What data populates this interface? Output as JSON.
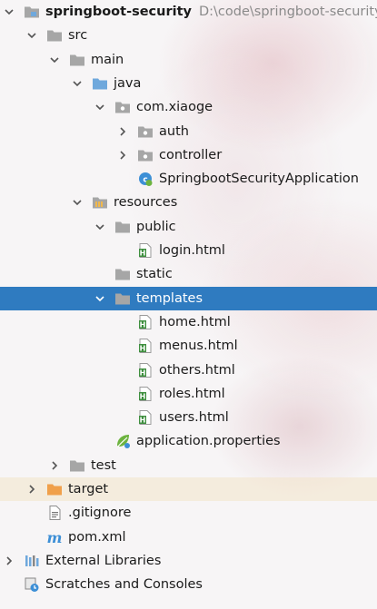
{
  "tree": [
    {
      "name": "tree-node-springboot-security",
      "level": 0,
      "arrow": "down",
      "icon": "module-folder-icon",
      "label": "springboot-security",
      "path": "D:\\code\\springboot-security",
      "bold": true
    },
    {
      "name": "tree-node-src",
      "level": 1,
      "arrow": "down",
      "icon": "folder-icon",
      "label": "src"
    },
    {
      "name": "tree-node-main",
      "level": 2,
      "arrow": "down",
      "icon": "folder-icon",
      "label": "main"
    },
    {
      "name": "tree-node-java",
      "level": 3,
      "arrow": "down",
      "icon": "source-folder-icon",
      "label": "java"
    },
    {
      "name": "tree-node-com-xiaoge",
      "level": 4,
      "arrow": "down",
      "icon": "package-icon",
      "label": "com.xiaoge"
    },
    {
      "name": "tree-node-auth",
      "level": 5,
      "arrow": "right",
      "icon": "package-icon",
      "label": "auth"
    },
    {
      "name": "tree-node-controller",
      "level": 5,
      "arrow": "right",
      "icon": "package-icon",
      "label": "controller"
    },
    {
      "name": "tree-node-springboot-security-application",
      "level": 5,
      "arrow": "none",
      "icon": "spring-boot-class-icon",
      "label": "SpringbootSecurityApplication"
    },
    {
      "name": "tree-node-resources",
      "level": 3,
      "arrow": "down",
      "icon": "resources-folder-icon",
      "label": "resources"
    },
    {
      "name": "tree-node-public",
      "level": 4,
      "arrow": "down",
      "icon": "folder-gray-icon",
      "label": "public"
    },
    {
      "name": "tree-node-login-html",
      "level": 5,
      "arrow": "none",
      "icon": "html-file-icon",
      "label": "login.html"
    },
    {
      "name": "tree-node-static",
      "level": 4,
      "arrow": "none",
      "icon": "folder-gray-icon",
      "label": "static"
    },
    {
      "name": "tree-node-templates",
      "level": 4,
      "arrow": "down",
      "icon": "folder-gray-icon",
      "label": "templates",
      "selected": true
    },
    {
      "name": "tree-node-home-html",
      "level": 5,
      "arrow": "none",
      "icon": "html-file-icon",
      "label": "home.html"
    },
    {
      "name": "tree-node-menus-html",
      "level": 5,
      "arrow": "none",
      "icon": "html-file-icon",
      "label": "menus.html"
    },
    {
      "name": "tree-node-others-html",
      "level": 5,
      "arrow": "none",
      "icon": "html-file-icon",
      "label": "others.html"
    },
    {
      "name": "tree-node-roles-html",
      "level": 5,
      "arrow": "none",
      "icon": "html-file-icon",
      "label": "roles.html"
    },
    {
      "name": "tree-node-users-html",
      "level": 5,
      "arrow": "none",
      "icon": "html-file-icon",
      "label": "users.html"
    },
    {
      "name": "tree-node-application-properties",
      "level": 4,
      "arrow": "none",
      "icon": "spring-properties-icon",
      "label": "application.properties"
    },
    {
      "name": "tree-node-test",
      "level": 2,
      "arrow": "right",
      "icon": "folder-icon",
      "label": "test"
    },
    {
      "name": "tree-node-target",
      "level": 1,
      "arrow": "right",
      "icon": "excluded-folder-icon",
      "label": "target",
      "highlight": true
    },
    {
      "name": "tree-node-gitignore",
      "level": 1,
      "arrow": "none",
      "icon": "text-file-icon",
      "label": ".gitignore"
    },
    {
      "name": "tree-node-pom-xml",
      "level": 1,
      "arrow": "none",
      "icon": "maven-icon",
      "label": "pom.xml"
    },
    {
      "name": "tree-node-external-libraries",
      "level": 0,
      "arrow": "right",
      "icon": "libraries-icon",
      "label": "External Libraries"
    },
    {
      "name": "tree-node-scratches-and-consoles",
      "level": 0,
      "arrow": "none",
      "icon": "scratches-icon",
      "label": "Scratches and Consoles"
    }
  ],
  "colors": {
    "selection": "#2f7bc0",
    "folder": "#a6a6a6",
    "source_folder": "#6fa8dc",
    "excluded_folder": "#f0a04b",
    "html": "#3f8f3f",
    "spring": "#6db33f"
  }
}
